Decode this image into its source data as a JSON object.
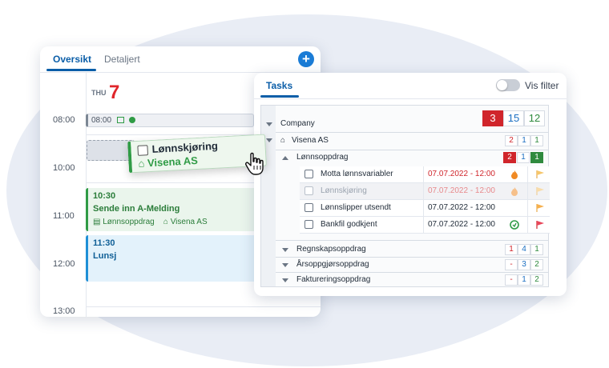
{
  "calendar": {
    "tabs": [
      "Oversikt",
      "Detaljert"
    ],
    "add_label": "+",
    "day_label": "THU",
    "day_number": "7",
    "times": [
      "08:00",
      "10:00",
      "11:00",
      "12:00",
      "13:00"
    ],
    "events": {
      "small": {
        "time": "08:00"
      },
      "amelding": {
        "time": "10:30",
        "title": "Sende inn A-Melding",
        "category": "Lønnsoppdrag",
        "client": "Visena AS"
      },
      "lunsj": {
        "time": "11:30",
        "title": "Lunsj"
      }
    }
  },
  "drag_chip": {
    "task": "Lønnskjøring",
    "client": "Visena AS"
  },
  "tasks_panel": {
    "tab": "Tasks",
    "filter_label": "Vis filter",
    "company_label": "Company",
    "company_counts": [
      "3",
      "15",
      "12"
    ],
    "client": {
      "name": "Visena AS",
      "counts": [
        "2",
        "1",
        "1"
      ]
    },
    "group": {
      "name": "Lønnsoppdrag",
      "counts": [
        "2",
        "1",
        "1"
      ]
    },
    "tasks": [
      {
        "name": "Motta lønnsvariabler",
        "date": "07.07.2022 - 12:00",
        "status": "overdue"
      },
      {
        "name": "Lønnskjøring",
        "date": "07.07.2022 - 12:00",
        "status": "dragging"
      },
      {
        "name": "Lønnslipper utsendt",
        "date": "07.07.2022 - 12:00",
        "status": "normal"
      },
      {
        "name": "Bankfil godkjent",
        "date": "07.07.2022 - 12:00",
        "status": "normal"
      }
    ],
    "other_groups": [
      {
        "name": "Regnskapsoppdrag",
        "counts": [
          "1",
          "4",
          "1"
        ]
      },
      {
        "name": "Årsoppgjørsoppdrag",
        "counts": [
          "-",
          "3",
          "2"
        ]
      },
      {
        "name": "Faktureringsoppdrag",
        "counts": [
          "-",
          "1",
          "2"
        ]
      }
    ]
  },
  "colors": {
    "accent": "#0b5ea8",
    "red": "#d0252b",
    "green": "#2f8a3e",
    "blue": "#1b6fc2",
    "event_green": "#2f9b45",
    "event_blue": "#1e8fd6"
  },
  "icons": [
    "add-icon",
    "monitor-icon",
    "check-circle-icon",
    "clipboard-icon",
    "store-icon",
    "hand-cursor-icon",
    "home-icon",
    "fire-icon",
    "flag-icon",
    "sync-icon"
  ]
}
